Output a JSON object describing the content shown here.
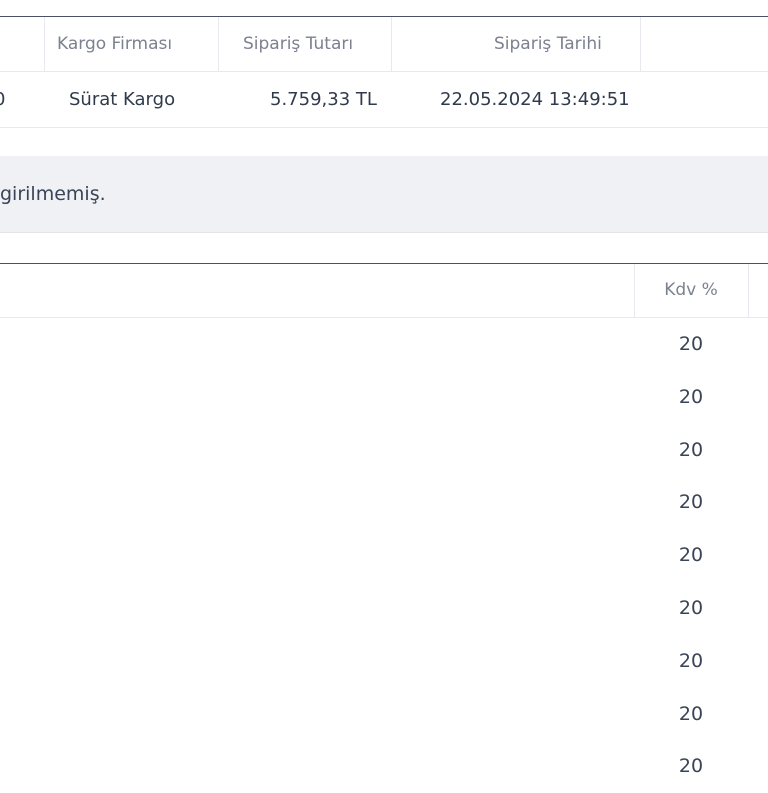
{
  "order_table": {
    "headers": {
      "cargo_company": "Kargo Firması",
      "order_amount": "Sipariş Tutarı",
      "order_date": "Sipariş Tarihi"
    },
    "row": {
      "cut_value": "0",
      "cargo_company": "Sürat Kargo",
      "order_amount": "5.759,33 TL",
      "order_date": "22.05.2024 13:49:51"
    }
  },
  "note": {
    "text": "girilmemiş."
  },
  "items_table": {
    "kdv_header": "Kdv %",
    "kdv_values": [
      "20",
      "20",
      "20",
      "20",
      "20",
      "20",
      "20",
      "20",
      "20"
    ]
  }
}
